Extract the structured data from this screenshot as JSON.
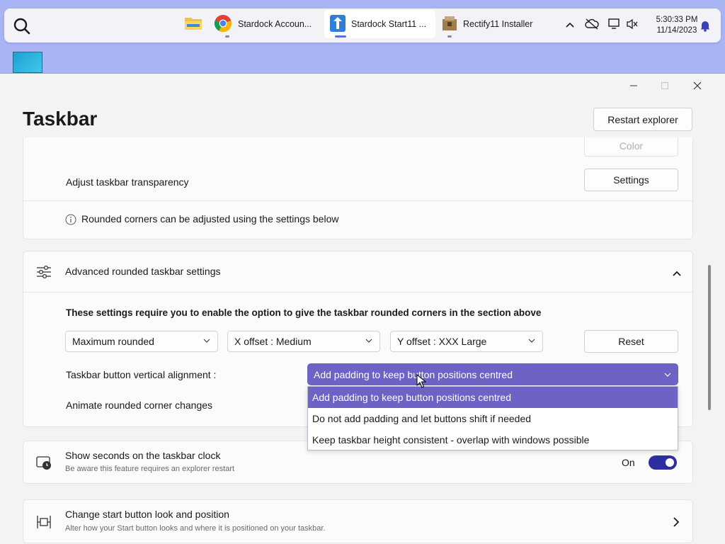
{
  "taskbar": {
    "apps": [
      {
        "name": "File Explorer",
        "label": ""
      },
      {
        "name": "Chrome",
        "label": "Stardock Accoun..."
      },
      {
        "name": "Stardock Start11",
        "label": "Stardock Start11 ..."
      },
      {
        "name": "Rectify11 Installer",
        "label": "Rectify11 Installer"
      }
    ],
    "clock": {
      "time": "5:30:33 PM",
      "date": "11/14/2023"
    }
  },
  "window": {
    "title": "Taskbar",
    "restart_button": "Restart explorer",
    "controls": {
      "minimize": "—",
      "maximize": "☐",
      "close": "✕"
    }
  },
  "transparency_card": {
    "color_button": "Color",
    "transparency_label": "Adjust taskbar transparency",
    "settings_button": "Settings",
    "rounded_info": "Rounded corners can be adjusted using the settings below"
  },
  "advanced_card": {
    "header": "Advanced rounded taskbar settings",
    "note": "These settings require you to enable the option to give the taskbar rounded corners in the section above",
    "rounding_select": "Maximum rounded",
    "x_offset_select": "X offset : Medium",
    "y_offset_select": "Y offset : XXX Large",
    "reset_button": "Reset",
    "alignment_label": "Taskbar button vertical alignment :",
    "alignment_value": "Add padding to keep button positions centred",
    "alignment_options": [
      "Add padding to keep button positions centred",
      "Do not add padding and let buttons shift if needed",
      "Keep taskbar height consistent - overlap with windows possible"
    ],
    "animate_label": "Animate rounded corner changes"
  },
  "seconds_card": {
    "title": "Show seconds on the taskbar clock",
    "subtitle": "Be aware this feature requires an explorer restart",
    "toggle_label": "On",
    "toggle_on": true
  },
  "start_button_card": {
    "title": "Change start button look and position",
    "subtitle": "Alter how your Start button looks and where it is positioned on your taskbar."
  },
  "colors": {
    "accent": "#6d63c4",
    "toggle": "#2b2f9f",
    "desktop": "#a9b4f5"
  }
}
